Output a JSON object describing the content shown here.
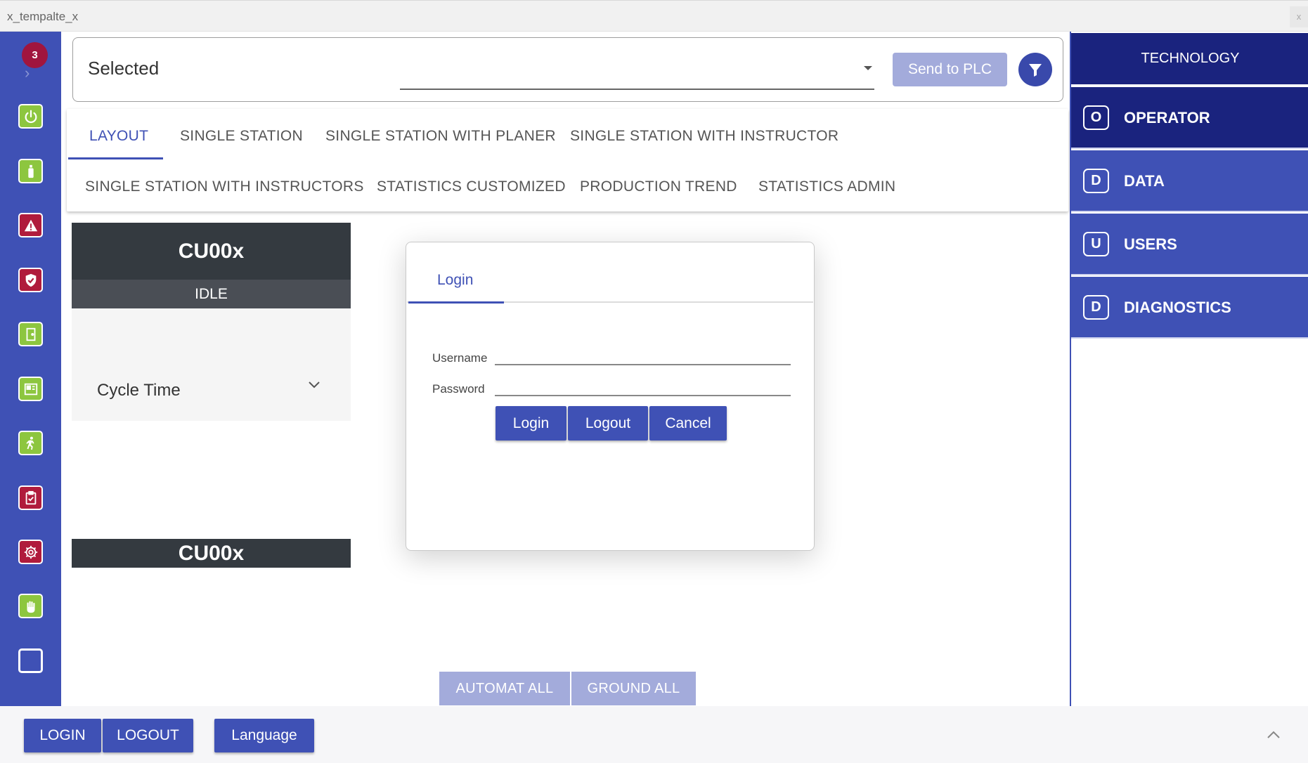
{
  "window": {
    "title": "x_tempalte_x",
    "close": "x"
  },
  "sidebar": {
    "badge_count": "3",
    "expand_glyph": "›",
    "icons": [
      {
        "name": "power-icon",
        "color": "green"
      },
      {
        "name": "bottle-icon",
        "color": "green"
      },
      {
        "name": "warning-icon",
        "color": "red"
      },
      {
        "name": "shield-check-icon",
        "color": "red"
      },
      {
        "name": "door-icon",
        "color": "green"
      },
      {
        "name": "machine-icon",
        "color": "green"
      },
      {
        "name": "emergency-exit-icon",
        "color": "green"
      },
      {
        "name": "clipboard-check-icon",
        "color": "red"
      },
      {
        "name": "settings-gear-icon",
        "color": "red"
      },
      {
        "name": "hand-stop-icon",
        "color": "green"
      },
      {
        "name": "empty-square-icon",
        "color": "none"
      }
    ]
  },
  "selector": {
    "label": "Selected",
    "value": "",
    "send_button": "Send to PLC",
    "filter_icon": "filter-icon"
  },
  "tabs": {
    "row1": [
      "LAYOUT",
      "SINGLE STATION",
      "SINGLE STATION WITH PLANER",
      "SINGLE STATION WITH INSTRUCTOR"
    ],
    "row2": [
      "SINGLE STATION WITH  INSTRUCTORS",
      "STATISTICS CUSTOMIZED",
      "PRODUCTION TREND",
      "STATISTICS ADMIN"
    ],
    "active": "LAYOUT"
  },
  "station": {
    "name": "CU00x",
    "state": "IDLE",
    "cycle_label": "Cycle Time",
    "second_name": "CU00x"
  },
  "dialog": {
    "tab": "Login",
    "username_label": "Username",
    "password_label": "Password",
    "username_value": "",
    "password_value": "",
    "buttons": {
      "login": "Login",
      "logout": "Logout",
      "cancel": "Cancel"
    }
  },
  "actions": {
    "automat_all": "AUTOMAT ALL",
    "ground_all": "GROUND ALL"
  },
  "right_panel": {
    "header": "TECHNOLOGY",
    "items": [
      {
        "letter": "O",
        "label": "OPERATOR",
        "active": true
      },
      {
        "letter": "D",
        "label": "DATA",
        "active": false
      },
      {
        "letter": "U",
        "label": "USERS",
        "active": false
      },
      {
        "letter": "D",
        "label": "DIAGNOSTICS",
        "active": false
      }
    ]
  },
  "bottom": {
    "login": "LOGIN",
    "logout": "LOGOUT",
    "language": "Language"
  },
  "colors": {
    "primary": "#3f51b5",
    "primary_dark": "#1a237e",
    "accent_green": "#8dc63f",
    "accent_red": "#b01b3c",
    "disabled": "#a3abdb",
    "station_dark": "#343a40"
  }
}
